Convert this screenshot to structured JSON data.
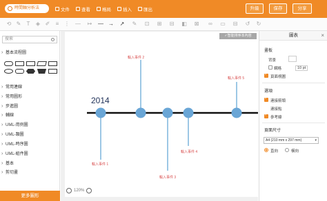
{
  "app": {
    "doc_title": "時間軸分析法",
    "menu": [
      "文件",
      "查看",
      "格局",
      "插入",
      "匯出"
    ],
    "buttons": {
      "upgrade": "升級",
      "save": "保存",
      "share": "分享"
    }
  },
  "left_panel": {
    "search_placeholder": "搜索",
    "categories_top": [
      "基本流程圖"
    ],
    "categories": [
      "常用連線",
      "常用圖形",
      "步進圖",
      "輔線",
      "UML-用例圖",
      "UML-類圖",
      "UML-時序圖",
      "UML-組件圖",
      "基本",
      "剪切畫"
    ],
    "more_button": "更多圖形"
  },
  "canvas": {
    "recommend_button": "✓智能排序本內容",
    "year_label": "2014",
    "events": [
      {
        "label": "輸入事件 1",
        "side": "bottom"
      },
      {
        "label": "輸入事件 2",
        "side": "top"
      },
      {
        "label": "輸入事件 3",
        "side": "bottom"
      },
      {
        "label": "輸入事件 4",
        "side": "bottom"
      },
      {
        "label": "輸入事件 5",
        "side": "top"
      }
    ],
    "zoom_value": "120%"
  },
  "right_panel": {
    "title": "圖表",
    "section_canvas": "畫板",
    "background_label": "背景",
    "grid_label": "網格",
    "grid_value": "10 pt",
    "show_page_label": "頁面視圖",
    "section_connect": "選項",
    "connect_arrows": "連接箭頭",
    "connect_points": "連接點",
    "guides": "參考線",
    "section_page_size": "頁面尺寸",
    "page_size_value": "A4 (210 mm x 297 mm)",
    "portrait": "直向",
    "landscape": "橫向"
  },
  "colors": {
    "brand": "#f08a26",
    "timeline_node": "#6aa6d6",
    "event_text": "#d94f4f",
    "year_text": "#22335a"
  }
}
